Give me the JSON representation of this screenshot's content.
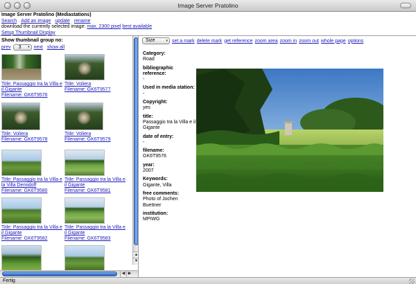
{
  "window": {
    "title": "Image Server Pratolino"
  },
  "header": {
    "app_title": "Image Server Pratolino (Mediastations)",
    "links": [
      "Search",
      "Add an image",
      "update",
      "rename"
    ],
    "download_text": "download the currently selected image:",
    "download_links": [
      "max. 2300 pixel",
      "best available"
    ],
    "setup_link": "Setup Thumbnail Display"
  },
  "left": {
    "group_label": "Show thumbnail group no:",
    "prev": "prev",
    "group_value": "3",
    "next": "next",
    "show_all": "show all",
    "thumbnails": [
      {
        "title": "Title: Passaggio tra la Villa e il Gigante",
        "filename": "Filename: GK6T9576"
      },
      {
        "title": "Title: Voliera",
        "filename": "Filename: GK6T9577"
      },
      {
        "title": "Title: Voliera",
        "filename": "Filename: GK6T9578"
      },
      {
        "title": "Title: Voliera",
        "filename": "Filename: GK6T9579"
      },
      {
        "title": "Title: Passaggio tra la Villa e la Villa Demidoff",
        "filename": "Filename: GK6T9580"
      },
      {
        "title": "Title: Passaggio tra la Villa e il Gigante",
        "filename": "Filename: GK6T9581"
      },
      {
        "title": "Title: Passaggio tra la Villa e il Gigante",
        "filename": "Filename: GK6T9582"
      },
      {
        "title": "Title: Passaggio tra la Villa e il Gigante",
        "filename": "Filename: GK6T9583"
      }
    ]
  },
  "toolbar": {
    "size_select": "Size",
    "links": [
      "set a mark",
      "delete mark",
      "get reference",
      "zoom area",
      "zoom in",
      "zoom out",
      "whole page",
      "options"
    ]
  },
  "metadata": [
    {
      "label": "Category:",
      "value": "Road"
    },
    {
      "label": "bibliographic reference:",
      "value": "-"
    },
    {
      "label": "Used in media station:",
      "value": "-"
    },
    {
      "label": "Copyright:",
      "value": "yes"
    },
    {
      "label": "title:",
      "value": "Passaggio tra la Villa e il Gigante"
    },
    {
      "label": "date of entry:",
      "value": "-"
    },
    {
      "label": "filename:",
      "value": "GK6T9576"
    },
    {
      "label": "year:",
      "value": "2007"
    },
    {
      "label": "Keywords:",
      "value": "Gigante, Villa"
    },
    {
      "label": "free comments:",
      "value": "Photo of Jochen Buettner"
    },
    {
      "label": "institution:",
      "value": "MPIWG"
    }
  ],
  "status": {
    "text": "Fertig"
  },
  "colors": {
    "link": "#1a1ab8",
    "scroll_accent": "#3f77c8"
  },
  "icons": {
    "scroll_up": "▲",
    "scroll_down": "▼",
    "scroll_left": "◀",
    "scroll_right": "▶",
    "select_arrow": "▾"
  }
}
